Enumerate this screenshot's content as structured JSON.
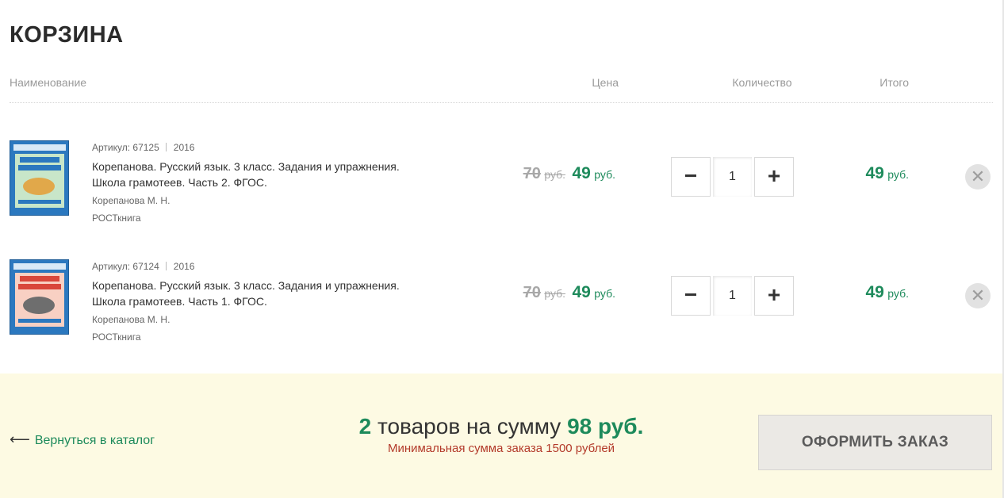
{
  "title": "КОРЗИНА",
  "columns": {
    "name": "Наименование",
    "price": "Цена",
    "quantity": "Количество",
    "total": "Итого"
  },
  "items": [
    {
      "article": "Артикул: 67125",
      "year": "2016",
      "name": "Корепанова. Русский язык. 3 класс. Задания и упражнения. Школа грамотеев. Часть 2. ФГОС.",
      "author": "Корепанова М. Н.",
      "publisher": "РОСТкнига",
      "old_price": "70",
      "old_currency": "руб.",
      "price": "49",
      "currency": "руб.",
      "quantity": "1",
      "total": "49",
      "total_currency": "руб.",
      "minus_label": "−",
      "plus_label": "+",
      "remove_label": "✕"
    },
    {
      "article": "Артикул: 67124",
      "year": "2016",
      "name": "Корепанова. Русский язык. 3 класс. Задания и упражнения. Школа грамотеев. Часть 1. ФГОС.",
      "author": "Корепанова М. Н.",
      "publisher": "РОСТкнига",
      "old_price": "70",
      "old_currency": "руб.",
      "price": "49",
      "currency": "руб.",
      "quantity": "1",
      "total": "49",
      "total_currency": "руб.",
      "minus_label": "−",
      "plus_label": "+",
      "remove_label": "✕"
    }
  ],
  "footer": {
    "back_arrow": "⟵",
    "back_label": "Вернуться в каталог",
    "summary_count": "2",
    "summary_text": " товаров на сумму ",
    "summary_amount": "98 руб.",
    "min_order": "Минимальная сумма заказа 1500 рублей",
    "checkout_label": "ОФОРМИТЬ ЗАКАЗ"
  },
  "colors": {
    "accent_green": "#1d8a5b",
    "warning_red": "#b33a2a",
    "footer_bg": "#fdfae3"
  }
}
